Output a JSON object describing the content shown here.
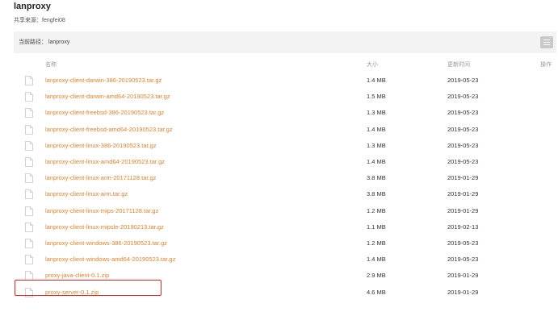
{
  "title": "lanproxy",
  "share": "共享来源：fengfei08",
  "path": "当前路径：  lanproxy",
  "columns": {
    "name": "名称",
    "size": "大小",
    "date": "更新时间",
    "action": "操作"
  },
  "files": [
    {
      "name": "lanproxy-client-darwin-386-20190523.tar.gz",
      "size": "1.4 MB",
      "date": "2019-05-23"
    },
    {
      "name": "lanproxy-client-darwin-amd64-20190523.tar.gz",
      "size": "1.5 MB",
      "date": "2019-05-23"
    },
    {
      "name": "lanproxy-client-freebsd-386-20190523.tar.gz",
      "size": "1.3 MB",
      "date": "2019-05-23"
    },
    {
      "name": "lanproxy-client-freebsd-amd64-20190523.tar.gz",
      "size": "1.4 MB",
      "date": "2019-05-23"
    },
    {
      "name": "lanproxy-client-linux-386-20190523.tar.gz",
      "size": "1.3 MB",
      "date": "2019-05-23"
    },
    {
      "name": "lanproxy-client-linux-amd64-20190523.tar.gz",
      "size": "1.4 MB",
      "date": "2019-05-23"
    },
    {
      "name": "lanproxy-client-linux-arm-20171128.tar.gz",
      "size": "3.8 MB",
      "date": "2019-01-29"
    },
    {
      "name": "lanproxy-client-linux-arm.tar.gz",
      "size": "3.8 MB",
      "date": "2019-01-29"
    },
    {
      "name": "lanproxy-client-linux-mips-20171128.tar.gz",
      "size": "1.2 MB",
      "date": "2019-01-29"
    },
    {
      "name": "lanproxy-client-linux-mipsle-20190213.tar.gz",
      "size": "1.1 MB",
      "date": "2019-02-13"
    },
    {
      "name": "lanproxy-client-windows-386-20190523.tar.gz",
      "size": "1.2 MB",
      "date": "2019-05-23"
    },
    {
      "name": "lanproxy-client-windows-amd64-20190523.tar.gz",
      "size": "1.4 MB",
      "date": "2019-05-23"
    },
    {
      "name": "proxy-java-client-0.1.zip",
      "size": "2.9 MB",
      "date": "2019-01-29"
    },
    {
      "name": "proxy-server-0.1.zip",
      "size": "4.6 MB",
      "date": "2019-01-29"
    }
  ],
  "highlight_color": "#e62323",
  "link_color": "#e0822e"
}
